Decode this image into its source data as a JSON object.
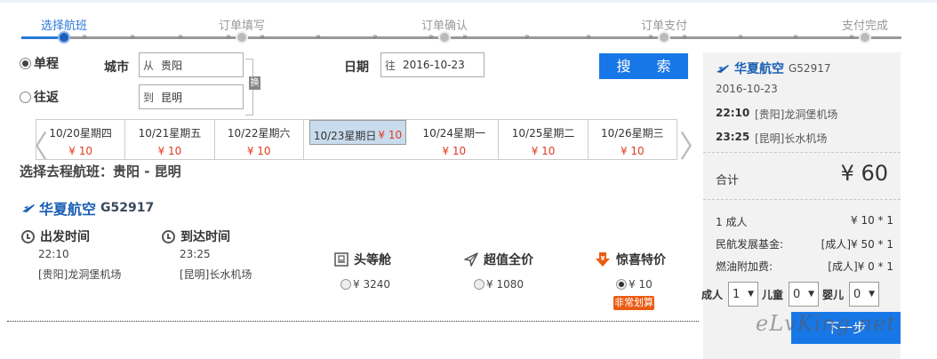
{
  "steps": [
    {
      "label": "选择航班",
      "active": true
    },
    {
      "label": "订单填写",
      "active": false
    },
    {
      "label": "订单确认",
      "active": false
    },
    {
      "label": "订单支付",
      "active": false
    },
    {
      "label": "支付完成",
      "active": false
    }
  ],
  "search": {
    "trip_oneway": "单程",
    "trip_round": "往返",
    "city_label": "城市",
    "from_prefix": "从",
    "from_value": "贵阳",
    "to_prefix": "到",
    "to_value": "昆明",
    "swap_label": "换",
    "date_label": "日期",
    "date_prefix": "往",
    "date_value": "2016-10-23",
    "search_button": "搜 索"
  },
  "dates": [
    {
      "date": "10/20星期四",
      "price": "¥ 10",
      "selected": false
    },
    {
      "date": "10/21星期五",
      "price": "¥ 10",
      "selected": false
    },
    {
      "date": "10/22星期六",
      "price": "¥ 10",
      "selected": false
    },
    {
      "date": "10/23星期日",
      "price": "¥ 10",
      "selected": true
    },
    {
      "date": "10/24星期一",
      "price": "¥ 10",
      "selected": false
    },
    {
      "date": "10/25星期二",
      "price": "¥ 10",
      "selected": false
    },
    {
      "date": "10/26星期三",
      "price": "¥ 10",
      "selected": false
    }
  ],
  "nav": {
    "prev": "〈",
    "next": "〉"
  },
  "section_title": "选择去程航班：贵阳 - 昆明",
  "flight": {
    "airline": "华夏航空",
    "number": "G52917",
    "depart_label": "出发时间",
    "depart_time": "22:10",
    "depart_airport": "[贵阳]龙洞堡机场",
    "arrive_label": "到达时间",
    "arrive_time": "23:25",
    "arrive_airport": "[昆明]长水机场",
    "cabins": [
      {
        "name": "头等舱",
        "price": "¥ 3240",
        "selected": false,
        "icon": "seat-icon"
      },
      {
        "name": "超值全价",
        "price": "¥ 1080",
        "selected": false,
        "icon": "paper-plane-icon"
      },
      {
        "name": "惊喜特价",
        "price": "¥ 10",
        "selected": true,
        "icon": "discount-tag-icon"
      }
    ],
    "badge": "非常划算"
  },
  "summary": {
    "airline": "华夏航空",
    "number": "G52917",
    "date": "2016-10-23",
    "depart_time": "22:10",
    "depart_airport": "[贵阳]龙洞堡机场",
    "arrive_time": "23:25",
    "arrive_airport": "[昆明]长水机场",
    "total_label": "合计",
    "total_value": "¥ 60",
    "fees": [
      {
        "label": "1 成人",
        "value": "¥ 10 * 1"
      },
      {
        "label": "民航发展基金:",
        "value": "[成人]¥ 50 * 1"
      },
      {
        "label": "燃油附加费:",
        "value": "[成人]¥ 0 * 1"
      }
    ],
    "adult_label": "成人",
    "adult_value": "1",
    "child_label": "儿童",
    "child_value": "0",
    "infant_label": "婴儿",
    "infant_value": "0",
    "next_button": "下一步"
  },
  "watermark": "eLvKing.net",
  "colors": {
    "accent": "#1877e6",
    "price": "#e03c22",
    "airline": "#1a5fb4",
    "badge": "#ea5b13"
  }
}
